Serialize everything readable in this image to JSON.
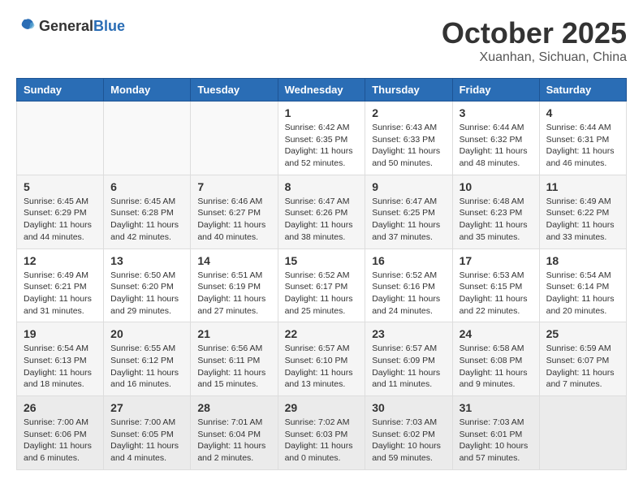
{
  "header": {
    "logo_general": "General",
    "logo_blue": "Blue",
    "month_year": "October 2025",
    "location": "Xuanhan, Sichuan, China"
  },
  "columns": [
    "Sunday",
    "Monday",
    "Tuesday",
    "Wednesday",
    "Thursday",
    "Friday",
    "Saturday"
  ],
  "weeks": [
    [
      {
        "day": "",
        "info": ""
      },
      {
        "day": "",
        "info": ""
      },
      {
        "day": "",
        "info": ""
      },
      {
        "day": "1",
        "info": "Sunrise: 6:42 AM\nSunset: 6:35 PM\nDaylight: 11 hours\nand 52 minutes."
      },
      {
        "day": "2",
        "info": "Sunrise: 6:43 AM\nSunset: 6:33 PM\nDaylight: 11 hours\nand 50 minutes."
      },
      {
        "day": "3",
        "info": "Sunrise: 6:44 AM\nSunset: 6:32 PM\nDaylight: 11 hours\nand 48 minutes."
      },
      {
        "day": "4",
        "info": "Sunrise: 6:44 AM\nSunset: 6:31 PM\nDaylight: 11 hours\nand 46 minutes."
      }
    ],
    [
      {
        "day": "5",
        "info": "Sunrise: 6:45 AM\nSunset: 6:29 PM\nDaylight: 11 hours\nand 44 minutes."
      },
      {
        "day": "6",
        "info": "Sunrise: 6:45 AM\nSunset: 6:28 PM\nDaylight: 11 hours\nand 42 minutes."
      },
      {
        "day": "7",
        "info": "Sunrise: 6:46 AM\nSunset: 6:27 PM\nDaylight: 11 hours\nand 40 minutes."
      },
      {
        "day": "8",
        "info": "Sunrise: 6:47 AM\nSunset: 6:26 PM\nDaylight: 11 hours\nand 38 minutes."
      },
      {
        "day": "9",
        "info": "Sunrise: 6:47 AM\nSunset: 6:25 PM\nDaylight: 11 hours\nand 37 minutes."
      },
      {
        "day": "10",
        "info": "Sunrise: 6:48 AM\nSunset: 6:23 PM\nDaylight: 11 hours\nand 35 minutes."
      },
      {
        "day": "11",
        "info": "Sunrise: 6:49 AM\nSunset: 6:22 PM\nDaylight: 11 hours\nand 33 minutes."
      }
    ],
    [
      {
        "day": "12",
        "info": "Sunrise: 6:49 AM\nSunset: 6:21 PM\nDaylight: 11 hours\nand 31 minutes."
      },
      {
        "day": "13",
        "info": "Sunrise: 6:50 AM\nSunset: 6:20 PM\nDaylight: 11 hours\nand 29 minutes."
      },
      {
        "day": "14",
        "info": "Sunrise: 6:51 AM\nSunset: 6:19 PM\nDaylight: 11 hours\nand 27 minutes."
      },
      {
        "day": "15",
        "info": "Sunrise: 6:52 AM\nSunset: 6:17 PM\nDaylight: 11 hours\nand 25 minutes."
      },
      {
        "day": "16",
        "info": "Sunrise: 6:52 AM\nSunset: 6:16 PM\nDaylight: 11 hours\nand 24 minutes."
      },
      {
        "day": "17",
        "info": "Sunrise: 6:53 AM\nSunset: 6:15 PM\nDaylight: 11 hours\nand 22 minutes."
      },
      {
        "day": "18",
        "info": "Sunrise: 6:54 AM\nSunset: 6:14 PM\nDaylight: 11 hours\nand 20 minutes."
      }
    ],
    [
      {
        "day": "19",
        "info": "Sunrise: 6:54 AM\nSunset: 6:13 PM\nDaylight: 11 hours\nand 18 minutes."
      },
      {
        "day": "20",
        "info": "Sunrise: 6:55 AM\nSunset: 6:12 PM\nDaylight: 11 hours\nand 16 minutes."
      },
      {
        "day": "21",
        "info": "Sunrise: 6:56 AM\nSunset: 6:11 PM\nDaylight: 11 hours\nand 15 minutes."
      },
      {
        "day": "22",
        "info": "Sunrise: 6:57 AM\nSunset: 6:10 PM\nDaylight: 11 hours\nand 13 minutes."
      },
      {
        "day": "23",
        "info": "Sunrise: 6:57 AM\nSunset: 6:09 PM\nDaylight: 11 hours\nand 11 minutes."
      },
      {
        "day": "24",
        "info": "Sunrise: 6:58 AM\nSunset: 6:08 PM\nDaylight: 11 hours\nand 9 minutes."
      },
      {
        "day": "25",
        "info": "Sunrise: 6:59 AM\nSunset: 6:07 PM\nDaylight: 11 hours\nand 7 minutes."
      }
    ],
    [
      {
        "day": "26",
        "info": "Sunrise: 7:00 AM\nSunset: 6:06 PM\nDaylight: 11 hours\nand 6 minutes."
      },
      {
        "day": "27",
        "info": "Sunrise: 7:00 AM\nSunset: 6:05 PM\nDaylight: 11 hours\nand 4 minutes."
      },
      {
        "day": "28",
        "info": "Sunrise: 7:01 AM\nSunset: 6:04 PM\nDaylight: 11 hours\nand 2 minutes."
      },
      {
        "day": "29",
        "info": "Sunrise: 7:02 AM\nSunset: 6:03 PM\nDaylight: 11 hours\nand 0 minutes."
      },
      {
        "day": "30",
        "info": "Sunrise: 7:03 AM\nSunset: 6:02 PM\nDaylight: 10 hours\nand 59 minutes."
      },
      {
        "day": "31",
        "info": "Sunrise: 7:03 AM\nSunset: 6:01 PM\nDaylight: 10 hours\nand 57 minutes."
      },
      {
        "day": "",
        "info": ""
      }
    ]
  ]
}
